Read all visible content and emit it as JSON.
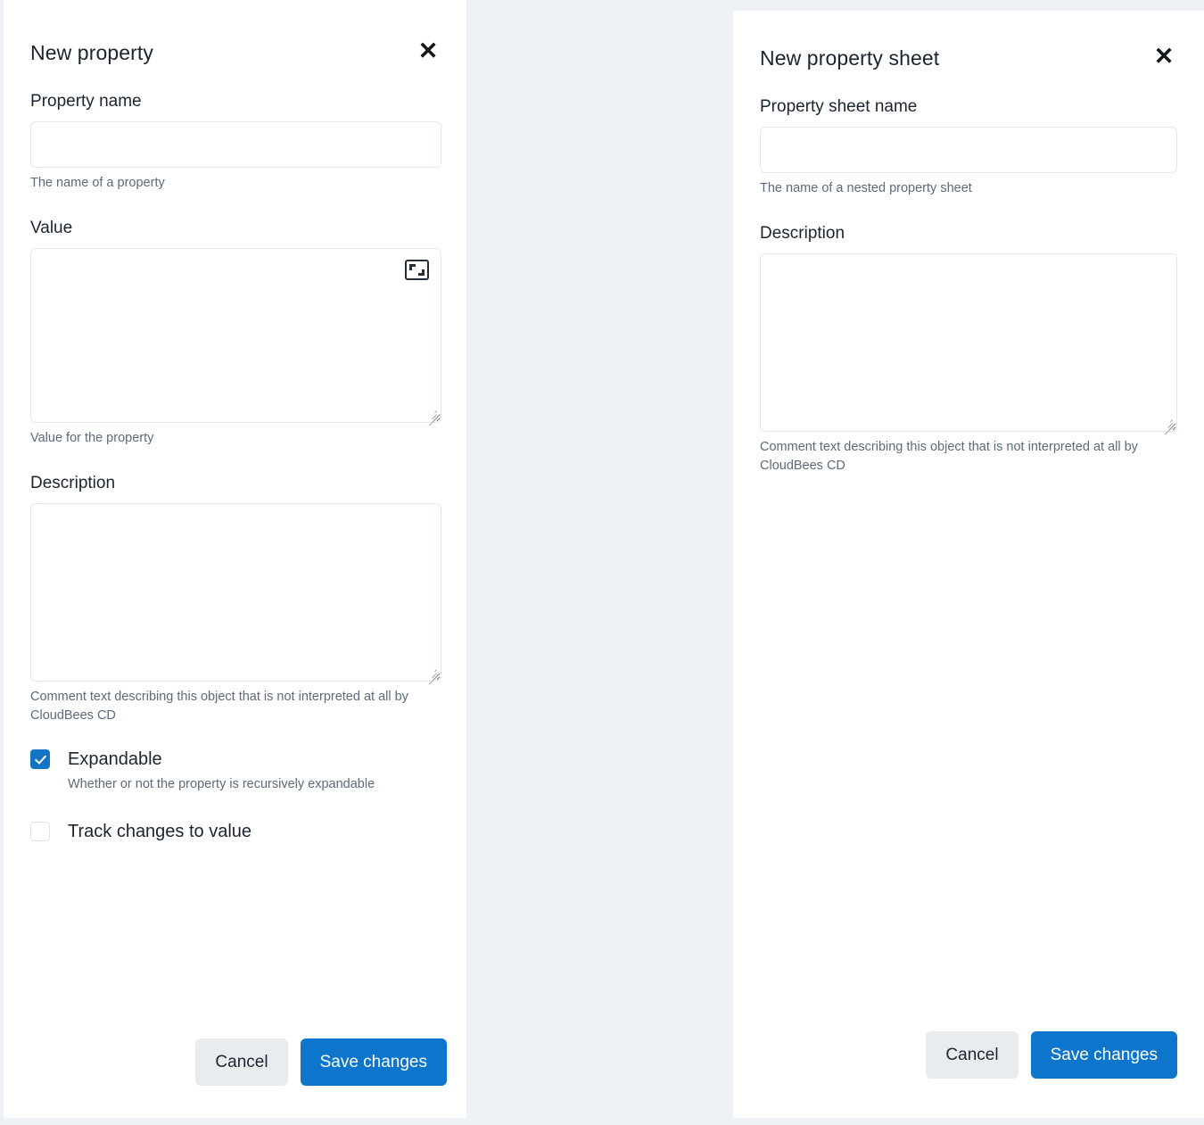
{
  "theme": {
    "backdrop": "#eef1f5",
    "panel_bg": "#ffffff",
    "text": "#1b2430",
    "help_text": "#5d6a7a",
    "border": "#e4e8ee",
    "primary": "#0d76cc",
    "checkbox_checked": "#1474c4",
    "cancel_bg": "#e9ecef"
  },
  "left_dialog": {
    "title": "New property",
    "close_label": "✕",
    "fields": {
      "property_name": {
        "label": "Property name",
        "value": "",
        "placeholder": "",
        "help": "The name of a property"
      },
      "value": {
        "label": "Value",
        "value": "",
        "placeholder": "",
        "help": "Value for the property",
        "expand_icon": "expand-editor-icon"
      },
      "description": {
        "label": "Description",
        "value": "",
        "placeholder": "",
        "help": "Comment text describing this object that is not interpreted at all by CloudBees CD"
      }
    },
    "checkboxes": [
      {
        "label": "Expandable",
        "checked": true,
        "help": "Whether or not the property is recursively expandable"
      },
      {
        "label": "Track changes to value",
        "checked": false,
        "help": ""
      }
    ],
    "buttons": {
      "cancel": "Cancel",
      "save": "Save changes"
    }
  },
  "right_dialog": {
    "title": "New property sheet",
    "close_label": "✕",
    "fields": {
      "property_sheet_name": {
        "label": "Property sheet name",
        "value": "",
        "placeholder": "",
        "help": "The name of a nested property sheet"
      },
      "description": {
        "label": "Description",
        "value": "",
        "placeholder": "",
        "help": "Comment text describing this object that is not interpreted at all by CloudBees CD"
      }
    },
    "buttons": {
      "cancel": "Cancel",
      "save": "Save changes"
    }
  }
}
